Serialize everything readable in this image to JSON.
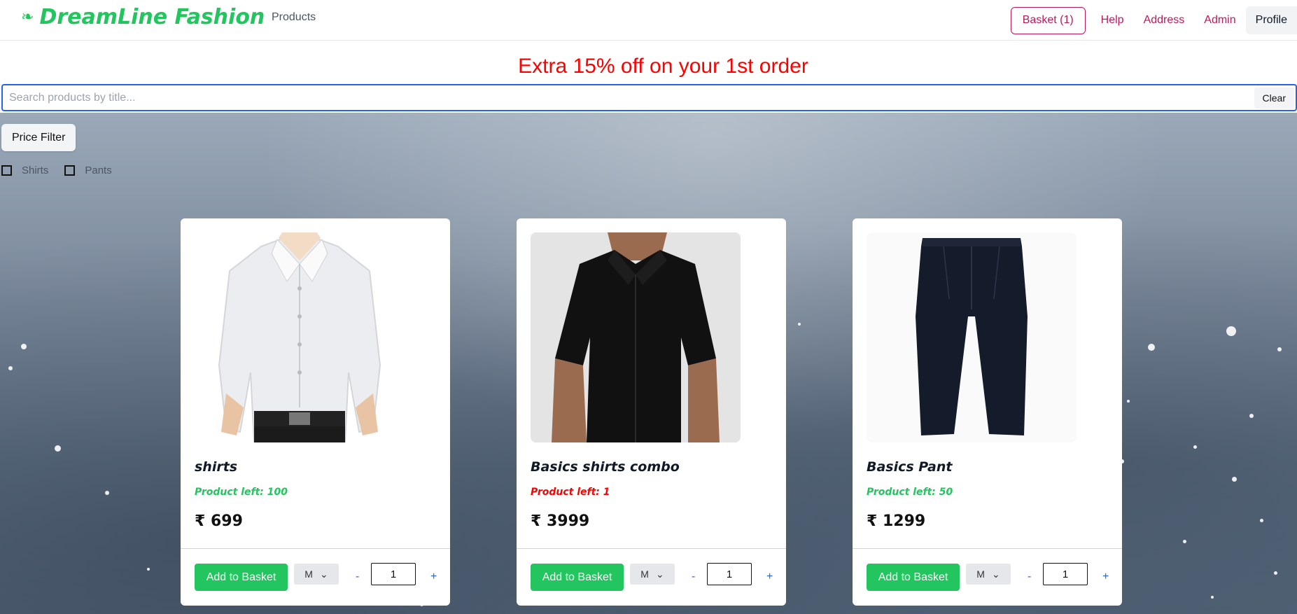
{
  "brand": {
    "icon": "lightning-icon",
    "name": "DreamLine Fashion",
    "color": "#22c55e"
  },
  "nav": {
    "products": "Products",
    "basket": "Basket (1)",
    "help": "Help",
    "address": "Address",
    "admin": "Admin",
    "profile": "Profile"
  },
  "promo": "Extra 15% off on your 1st order",
  "search": {
    "placeholder": "Search products by title...",
    "value": "",
    "clear": "Clear"
  },
  "filter": {
    "price_button": "Price Filter",
    "categories": [
      {
        "label": "Shirts",
        "checked": false
      },
      {
        "label": "Pants",
        "checked": false
      }
    ]
  },
  "products": [
    {
      "title": "shirts",
      "stock": "Product left: 100",
      "stock_color": "#22c55e",
      "price": "₹ 699",
      "size": "M",
      "qty": "1",
      "add": "Add to Basket",
      "minus": "-",
      "plus": "+"
    },
    {
      "title": "Basics shirts combo",
      "stock": "Product left: 1",
      "stock_color": "#ff0000",
      "price": "₹ 3999",
      "size": "M",
      "qty": "1",
      "add": "Add to Basket",
      "minus": "-",
      "plus": "+"
    },
    {
      "title": "Basics Pant",
      "stock": "Product left: 50",
      "stock_color": "#22c55e",
      "price": "₹ 1299",
      "size": "M",
      "qty": "1",
      "add": "Add to Basket",
      "minus": "-",
      "plus": "+"
    }
  ],
  "colors": {
    "accent": "#be185d",
    "promo": "#ff0000",
    "button": "#22c55e",
    "link": "#2563eb"
  }
}
